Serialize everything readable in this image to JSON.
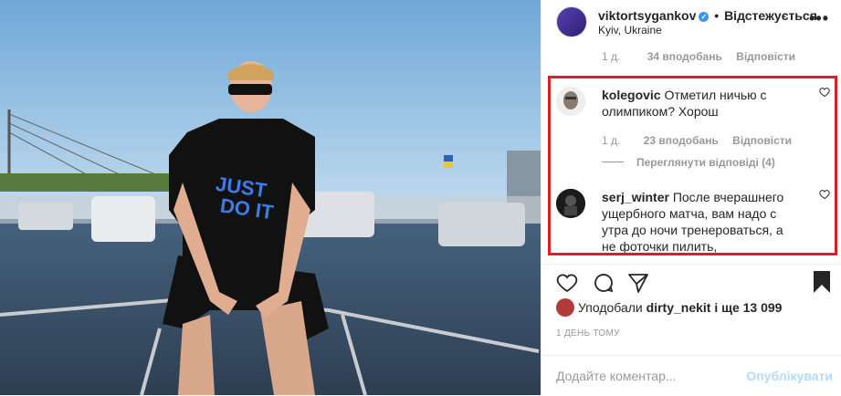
{
  "post": {
    "username": "viktortsygankov",
    "dot": "•",
    "follow_label": "Відстежується",
    "location": "Kyiv, Ukraine",
    "more": "•••"
  },
  "top_comment_meta": {
    "age": "1 д.",
    "likes": "34 вподобань",
    "reply": "Відповісти"
  },
  "comments": [
    {
      "username": "kolegovic",
      "text": "Отметил ничью с олимпиком? Хорош",
      "age": "1 д.",
      "likes": "23 вподобань",
      "reply": "Відповісти",
      "view_replies": "Переглянути відповіді (4)"
    },
    {
      "username": "serj_winter",
      "text": "После вчерашнего ущербного матча, вам надо с утра до ночи тренероваться, а не фоточки пилить,"
    }
  ],
  "likes_line": {
    "prefix": "Уподобали",
    "user": "dirty_nekit",
    "suffix": "і ще 13 099"
  },
  "time_ago": "1 ДЕНЬ ТОМУ",
  "add_comment": {
    "placeholder": "Додайте коментар...",
    "post_label": "Опублікувати"
  },
  "colors": {
    "highlight": "#e31b23",
    "link_blue": "#3897f0",
    "post_disabled": "#b3dbff"
  }
}
